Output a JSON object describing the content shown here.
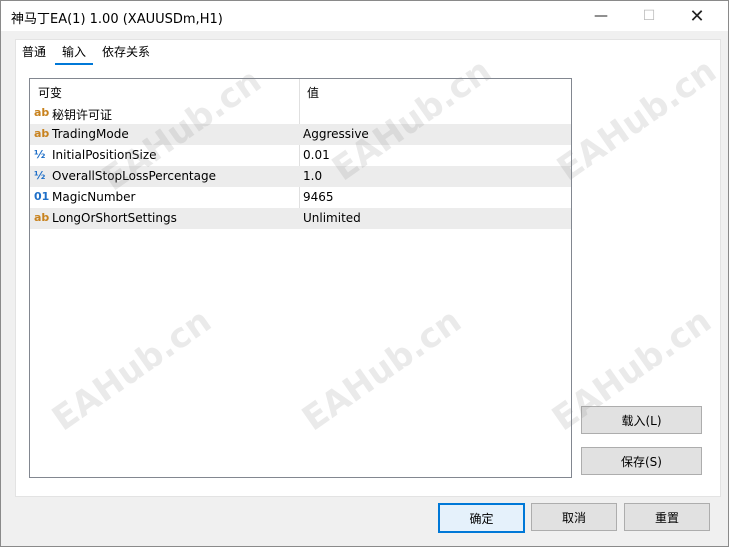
{
  "window": {
    "title": "神马丁EA(1) 1.00 (XAUUSDm,H1)",
    "minimize": "—",
    "maximize": "☐",
    "close": "✕"
  },
  "tabs": [
    {
      "label": "普通",
      "active": false
    },
    {
      "label": "输入",
      "active": true
    },
    {
      "label": "依存关系",
      "active": false
    }
  ],
  "grid": {
    "headers": {
      "variable": "可变",
      "value": "值"
    },
    "rows": [
      {
        "icon": "ab",
        "icon_name": "string-type-icon",
        "name": "秘钥许可证",
        "value": ""
      },
      {
        "icon": "ab",
        "icon_name": "string-type-icon",
        "name": "TradingMode",
        "value": "Aggressive"
      },
      {
        "icon": "½",
        "icon_name": "double-type-icon",
        "name": "InitialPositionSize",
        "value": "0.01"
      },
      {
        "icon": "½",
        "icon_name": "double-type-icon",
        "name": "OverallStopLossPercentage",
        "value": "1.0"
      },
      {
        "icon": "01",
        "icon_name": "integer-type-icon",
        "name": "MagicNumber",
        "value": "9465"
      },
      {
        "icon": "ab",
        "icon_name": "string-type-icon",
        "name": "LongOrShortSettings",
        "value": "Unlimited"
      }
    ]
  },
  "buttons": {
    "load": "载入(L)",
    "save": "保存(S)",
    "ok": "确定",
    "cancel": "取消",
    "reset": "重置"
  },
  "watermark": "EAHub.cn"
}
